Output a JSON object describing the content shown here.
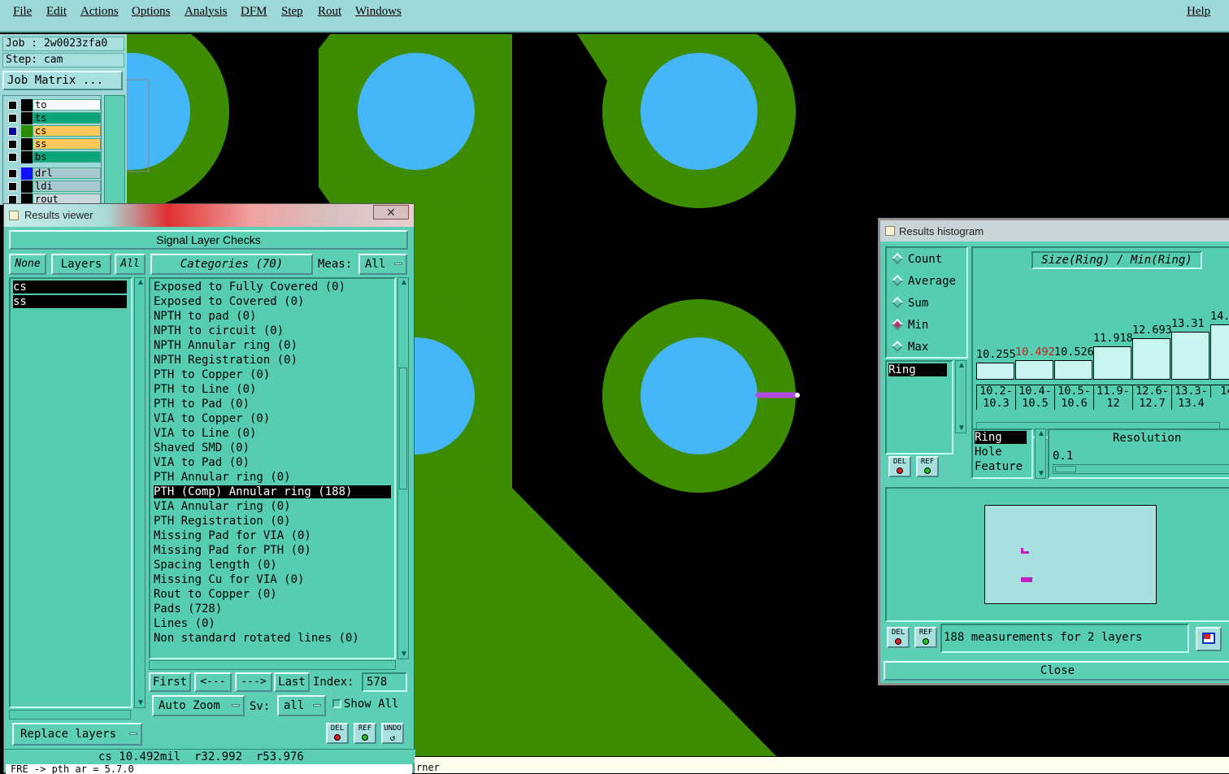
{
  "menubar": {
    "items": [
      "File",
      "Edit",
      "Actions",
      "Options",
      "Analysis",
      "DFM",
      "Step",
      "Rout",
      "Windows"
    ],
    "help": "Help"
  },
  "job": {
    "job_label": "Job : 2w0023zfa0",
    "step_label": "Step: cam",
    "matrix_button": "Job Matrix ..."
  },
  "layers": [
    {
      "name": "to",
      "box": "#ffffff",
      "swatch": "#000000"
    },
    {
      "name": "ts",
      "box": "#0aa57a",
      "swatch": "#000000"
    },
    {
      "name": "cs",
      "box": "#ffc85a",
      "swatch": "#2e8b00"
    },
    {
      "name": "ss",
      "box": "#ffc85a",
      "swatch": "#000000"
    },
    {
      "name": "bs",
      "box": "#0aa57a",
      "swatch": "#000000"
    },
    {
      "name": "drl",
      "box": "#a8c8d0",
      "swatch": "#1010ff"
    },
    {
      "name": "ldi",
      "box": "#a8c8d0",
      "swatch": "#000000"
    },
    {
      "name": "rout",
      "box": "#a8c8d0",
      "swatch": "#000000"
    }
  ],
  "results_viewer": {
    "title": "Results viewer",
    "header": "Signal Layer Checks",
    "none_btn": "None",
    "layers_btn": "Layers",
    "all_btn": "All",
    "categories_btn": "Categories (70)",
    "meas_label": "Meas:",
    "meas_value": "All",
    "layer_list": [
      "cs",
      "ss"
    ],
    "categories": [
      "Exposed to Fully Covered (0)",
      "Exposed to Covered (0)",
      "NPTH to pad (0)",
      "NPTH to circuit (0)",
      "NPTH Annular ring (0)",
      "NPTH Registration (0)",
      "PTH to Copper (0)",
      "PTH to Line (0)",
      "PTH to Pad (0)",
      "VIA to Copper (0)",
      "VIA to Line (0)",
      "Shaved SMD (0)",
      "VIA to Pad (0)",
      "PTH Annular ring (0)",
      "PTH (Comp) Annular ring (188)",
      "VIA Annular ring (0)",
      "PTH Registration (0)",
      "Missing Pad for VIA (0)",
      "Missing Pad for PTH (0)",
      "Spacing length (0)",
      "Missing Cu for VIA (0)",
      "Rout to Copper (0)",
      "Pads (728)",
      "Lines (0)",
      "Non standard rotated lines (0)"
    ],
    "selected_category": "PTH (Comp) Annular ring (188)",
    "nav": {
      "first": "First",
      "prev": "<---",
      "next": "--->",
      "last": "Last",
      "index_label": "Index:",
      "index_value": "578"
    },
    "auto_zoom": "Auto Zoom",
    "sv_label": "Sv:",
    "sv_value": "all",
    "show_all": "Show All",
    "replace_layers": "Replace layers",
    "del": "DEL",
    "ref": "REF",
    "undo": "UNDO",
    "status": "cs 10.492mil  r32.992  r53.976"
  },
  "histogram": {
    "title": "Results histogram",
    "radios": [
      "Count",
      "Average",
      "Sum",
      "Min",
      "Max"
    ],
    "selected_radio": "Min",
    "chart_title": "Size(Ring) / Min(Ring)",
    "measure_list": [
      "Ring"
    ],
    "type_list": [
      "Ring",
      "Hole",
      "Feature"
    ],
    "resolution_label": "Resolution",
    "resolution_value": "0.1",
    "measurements": "188 measurements for 2 layers",
    "close": "Close",
    "del": "DEL",
    "ref": "REF"
  },
  "chart_data": {
    "type": "bar",
    "title": "Size(Ring) / Min(Ring)",
    "categories": [
      "10.2-10.3",
      "10.4-10.5",
      "10.5-10.6",
      "11.9-12",
      "12.6-12.7",
      "13.3-13.4",
      "14."
    ],
    "values": [
      10.255,
      10.492,
      10.526,
      11.918,
      12.693,
      13.31,
      14.0
    ],
    "value_labels": [
      "10.255",
      "10.492",
      "10.526",
      "11.918",
      "12.693",
      "13.31",
      "14."
    ],
    "bin_labels": [
      [
        "10.2-",
        "10.3"
      ],
      [
        "10.4-",
        "10.5"
      ],
      [
        "10.5-",
        "10.6"
      ],
      [
        "11.9-",
        "12"
      ],
      [
        "12.6-",
        "12.7"
      ],
      [
        "13.3-",
        "13.4"
      ],
      [
        "14.",
        ""
      ]
    ],
    "highlight_index": 1,
    "highlight_color": "#d81818"
  },
  "colors": {
    "copper": "#3d8c00",
    "hole": "#45b6f7",
    "measure_marker": "#b04ae0"
  },
  "bottom_text": {
    "left": "FRE -> pth_ar = 5.7.0",
    "right": "rner"
  }
}
